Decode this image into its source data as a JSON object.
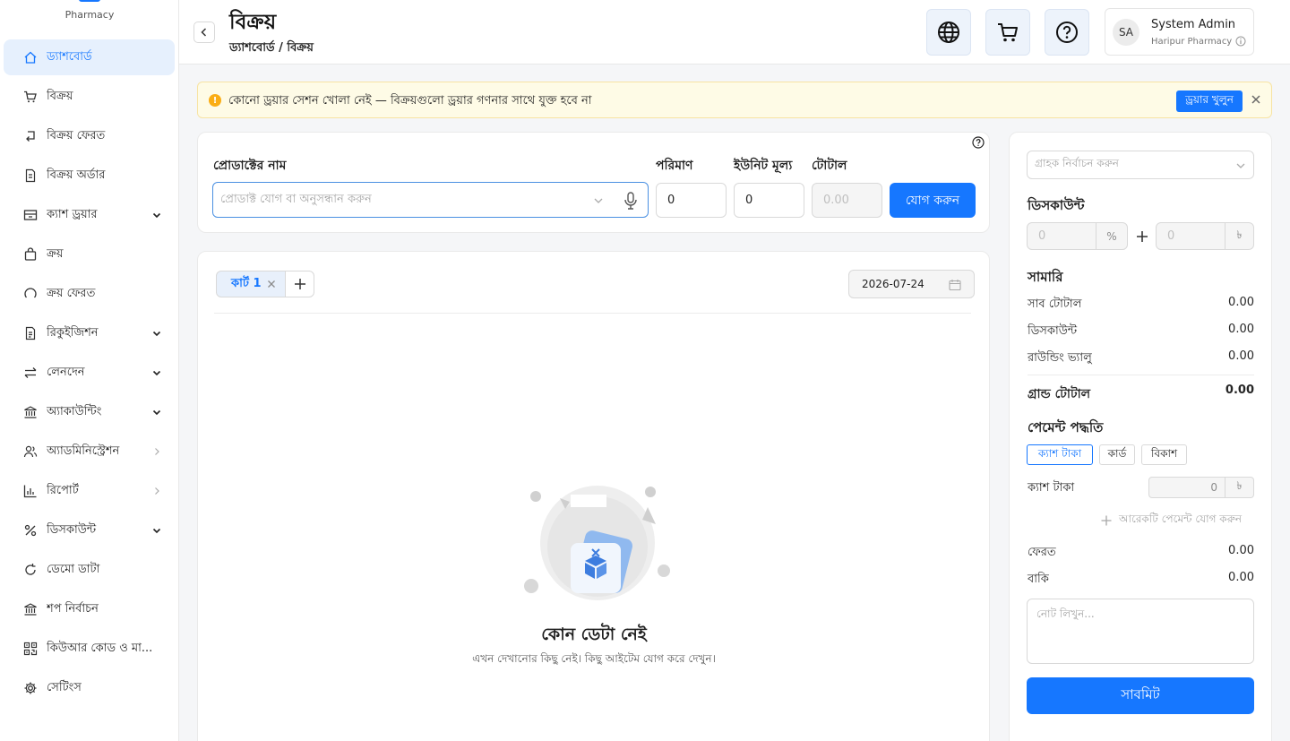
{
  "brand": {
    "subtitle": "Pharmacy"
  },
  "sidebar": {
    "items": [
      {
        "label": "ড্যাশবোর্ড",
        "icon": "home-icon",
        "active": true
      },
      {
        "label": "বিক্রয়",
        "icon": "cart-icon"
      },
      {
        "label": "বিক্রয় ফেরত",
        "icon": "return-icon"
      },
      {
        "label": "বিক্রয় অর্ডার",
        "icon": "file-icon"
      },
      {
        "label": "ক্যাশ ড্রয়ার",
        "icon": "drawer-icon",
        "arrow": "down"
      },
      {
        "label": "ক্রয়",
        "icon": "bag-icon"
      },
      {
        "label": "ক্রয় ফেরত",
        "icon": "undo-icon"
      },
      {
        "label": "রিকুইজিশন",
        "icon": "file-text-icon",
        "arrow": "down"
      },
      {
        "label": "লেনদেন",
        "icon": "swap-icon",
        "arrow": "down"
      },
      {
        "label": "অ্যাকাউন্টিং",
        "icon": "bank-icon",
        "arrow": "down"
      },
      {
        "label": "অ্যাডমিনিস্ট্রেশন",
        "icon": "users-icon",
        "arrow": "right"
      },
      {
        "label": "রিপোর্ট",
        "icon": "bar-chart-icon",
        "arrow": "right"
      },
      {
        "label": "ডিসকাউন্ট",
        "icon": "percent-icon",
        "arrow": "down"
      },
      {
        "label": "ডেমো ডাটা",
        "icon": "reload-icon"
      },
      {
        "label": "শপ নির্বাচন",
        "icon": "shop-icon"
      },
      {
        "label": "কিউআর কোড ও মা...",
        "icon": "qrcode-icon"
      },
      {
        "label": "সেটিংস",
        "icon": "gear-icon"
      }
    ]
  },
  "header": {
    "title": "বিক্রয়",
    "breadcrumb": "ড্যাশবোর্ড / বিক্রয়",
    "user": {
      "initials": "SA",
      "name": "System Admin",
      "org": "Haripur Pharmacy"
    }
  },
  "alert": {
    "text": "কোনো ড্রয়ার সেশন খোলা নেই — বিক্রয়গুলো ড্রয়ার গণনার সাথে যুক্ত হবে না",
    "button": "ড্রয়ার খুলুন"
  },
  "entry": {
    "product_label": "প্রোডাক্টের নাম",
    "product_placeholder": "প্রোডাক্ট যোগ বা অনুসন্ধান করুন",
    "qty_label": "পরিমাণ",
    "qty_value": "0",
    "unit_price_label": "ইউনিট মূল্য",
    "unit_price_value": "0",
    "total_label": "টোটাল",
    "total_value": "0.00",
    "add_button": "যোগ করুন"
  },
  "cart": {
    "tab_label": "কার্ট 1",
    "date": "2026-07-24",
    "empty_title": "কোন ডেটা নেই",
    "empty_desc": "এখন দেখানোর কিছু নেই। কিছু আইটেম যোগ করে দেখুন।"
  },
  "panel": {
    "customer_placeholder": "গ্রাহক নির্বাচন করুন",
    "discount_title": "ডিসকাউন্ট",
    "discount_pct_value": "0",
    "discount_pct_suffix": "%",
    "discount_amt_value": "0",
    "currency": "৳",
    "summary_title": "সামারি",
    "subtotal_label": "সাব টোটাল",
    "subtotal_value": "0.00",
    "discount_label": "ডিসকাউন্ট",
    "discount_value": "0.00",
    "rounding_label": "রাউন্ডিং ভ্যালু",
    "rounding_value": "0.00",
    "grand_total_label": "গ্রান্ড টোটাল",
    "grand_total_value": "0.00",
    "payment_title": "পেমেন্ট পদ্ধতি",
    "payment_options": [
      "ক্যাশ টাকা",
      "কার্ড",
      "বিকাশ"
    ],
    "cash_label": "ক্যাশ টাকা",
    "cash_value": "0",
    "add_payment": "আরেকটি পেমেন্ট যোগ করুন",
    "change_label": "ফেরত",
    "change_value": "0.00",
    "due_label": "বাকি",
    "due_value": "0.00",
    "note_placeholder": "নোট লিখুন...",
    "submit": "সাবমিট"
  },
  "colors": {
    "primary": "#1677ff",
    "warning": "#faad14",
    "alert_bg": "#fefbe6"
  }
}
